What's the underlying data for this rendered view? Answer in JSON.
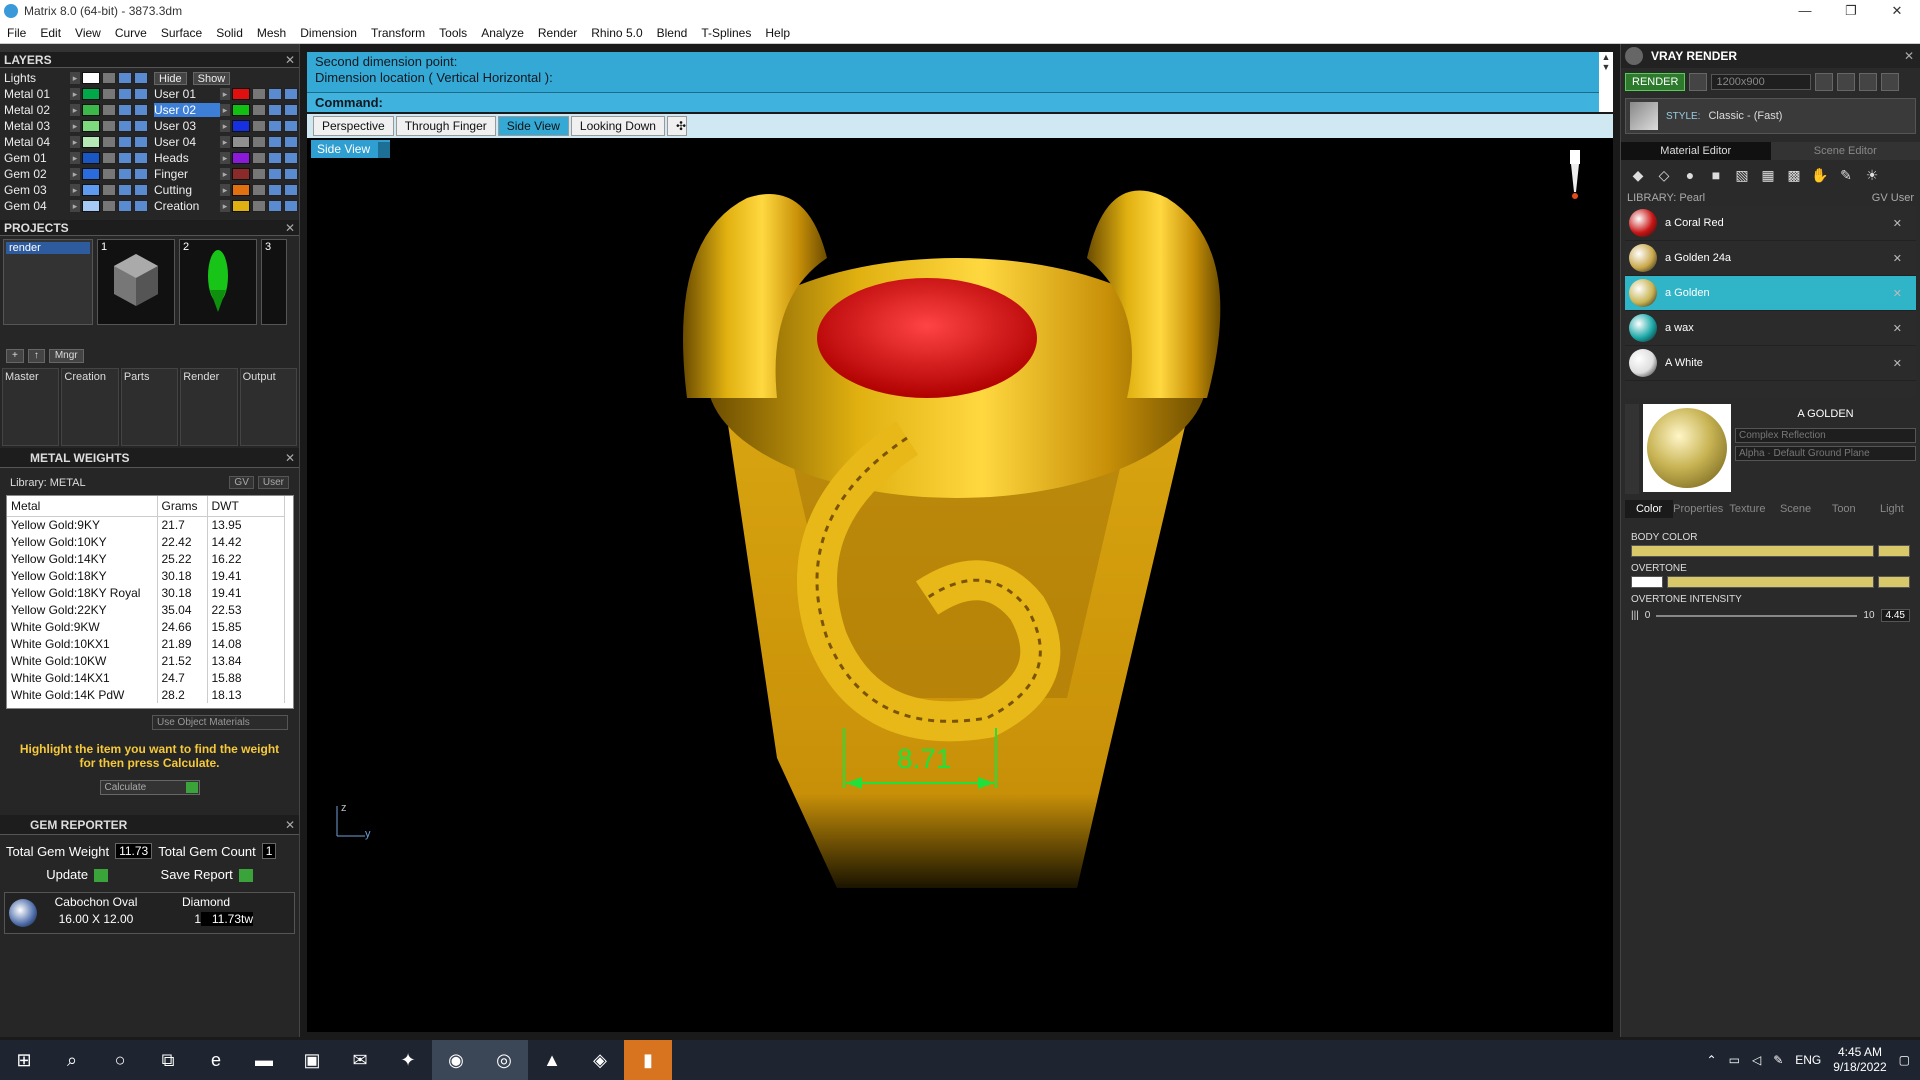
{
  "window": {
    "title": "Matrix 8.0 (64-bit) - 3873.3dm",
    "minimize": "—",
    "restore": "❐",
    "close": "✕"
  },
  "menu": [
    "File",
    "Edit",
    "View",
    "Curve",
    "Surface",
    "Solid",
    "Mesh",
    "Dimension",
    "Transform",
    "Tools",
    "Analyze",
    "Render",
    "Rhino 5.0",
    "Blend",
    "T-Splines",
    "Help"
  ],
  "layers": {
    "title": "LAYERS",
    "close": "✕",
    "hide": "Hide",
    "show": "Show",
    "left": [
      {
        "name": "Lights",
        "color": "#ffffff"
      },
      {
        "name": "Metal 01",
        "color": "#00a84a"
      },
      {
        "name": "Metal 02",
        "color": "#3cb84a"
      },
      {
        "name": "Metal 03",
        "color": "#7ed87e"
      },
      {
        "name": "Metal 04",
        "color": "#b7e9b7"
      },
      {
        "name": "Gem 01",
        "color": "#1a57c2"
      },
      {
        "name": "Gem 02",
        "color": "#2a6bdd"
      },
      {
        "name": "Gem 03",
        "color": "#5e9bf0"
      },
      {
        "name": "Gem 04",
        "color": "#a6c8f5"
      }
    ],
    "right": [
      {
        "name": "",
        "color": ""
      },
      {
        "name": "User 01",
        "color": "#e01010"
      },
      {
        "name": "User 02",
        "color": "#12c012"
      },
      {
        "name": "User 03",
        "color": "#1430e0"
      },
      {
        "name": "User 04",
        "color": "#909090"
      },
      {
        "name": "Heads",
        "color": "#8a1ad8"
      },
      {
        "name": "Finger",
        "color": "#8a2a2a"
      },
      {
        "name": "Cutting",
        "color": "#e07010"
      },
      {
        "name": "Creation",
        "color": "#e0b010"
      }
    ]
  },
  "projects": {
    "title": "PROJECTS",
    "close": "✕",
    "items": [
      "render"
    ],
    "thumbs": [
      "1",
      "2",
      "3"
    ],
    "mngr": "Mngr"
  },
  "categories": [
    "Master",
    "Creation",
    "Parts",
    "Render",
    "Output"
  ],
  "metal_weights": {
    "title": "METAL WEIGHTS",
    "close": "✕",
    "library": "Library: METAL",
    "gv": "GV",
    "user": "User",
    "headers": [
      "Metal",
      "Grams",
      "DWT"
    ],
    "rows": [
      [
        "Yellow Gold:9KY",
        "21.7",
        "13.95"
      ],
      [
        "Yellow Gold:10KY",
        "22.42",
        "14.42"
      ],
      [
        "Yellow Gold:14KY",
        "25.22",
        "16.22"
      ],
      [
        "Yellow Gold:18KY",
        "30.18",
        "19.41"
      ],
      [
        "Yellow Gold:18KY Royal",
        "30.18",
        "19.41"
      ],
      [
        "Yellow Gold:22KY",
        "35.04",
        "22.53"
      ],
      [
        "White Gold:9KW",
        "24.66",
        "15.85"
      ],
      [
        "White Gold:10KX1",
        "21.89",
        "14.08"
      ],
      [
        "White Gold:10KW",
        "21.52",
        "13.84"
      ],
      [
        "White Gold:14KX1",
        "24.7",
        "15.88"
      ],
      [
        "White Gold:14K PdW",
        "28.2",
        "18.13"
      ]
    ],
    "use_object": "Use Object Materials",
    "hint": "Highlight the item you want to find the weight for then press Calculate.",
    "calculate": "Calculate"
  },
  "gem_reporter": {
    "title": "GEM REPORTER",
    "close": "✕",
    "total_weight_label": "Total Gem Weight",
    "total_weight": "11.73",
    "total_count_label": "Total Gem Count",
    "total_count": "1",
    "update": "Update",
    "save": "Save Report",
    "gem": {
      "shape": "Cabochon Oval",
      "size": "16.00 X 12.00",
      "material": "Diamond",
      "count": "1",
      "weight": "11.73tw"
    }
  },
  "command": {
    "line1": "Second dimension point:",
    "line2": "Dimension location ( Vertical  Horizontal ):",
    "prompt": "Command:"
  },
  "view_tabs": [
    {
      "label": "Perspective",
      "active": false
    },
    {
      "label": "Through Finger",
      "active": false
    },
    {
      "label": "Side View",
      "active": true
    },
    {
      "label": "Looking Down",
      "active": false
    }
  ],
  "view_tab_add": "✣",
  "viewport": {
    "label": "Side View",
    "dimension": "8.71",
    "axis_z": "z",
    "axis_y": "y"
  },
  "vray": {
    "title": "VRAY RENDER",
    "close": "✕",
    "render": "RENDER",
    "resolution": "1200x900",
    "style_label": "STYLE:",
    "style_value": "Classic - (Fast)",
    "tabs": [
      "Material Editor",
      "Scene Editor"
    ],
    "library": "LIBRARY: Pearl",
    "gv": "GV",
    "user": "User",
    "materials": [
      {
        "name": "a Coral Red",
        "color": "#c81414",
        "selected": false
      },
      {
        "name": "a Golden 24a",
        "color": "#c9a84c",
        "selected": false
      },
      {
        "name": "a Golden",
        "color": "#c8b454",
        "selected": true
      },
      {
        "name": "a wax",
        "color": "#1aa8a8",
        "selected": false
      },
      {
        "name": "A White",
        "color": "#dedede",
        "selected": false
      }
    ],
    "current": "A GOLDEN",
    "reflection": "Complex Reflection",
    "alpha": "Alpha",
    "ground": "Default Ground Plane",
    "prop_tabs": [
      "Color",
      "Properties",
      "Texture",
      "Scene",
      "Toon",
      "Light"
    ],
    "body_color": "BODY COLOR",
    "overtone": "OVERTONE",
    "overtone_intensity": "OVERTONE INTENSITY",
    "oi_min": "0",
    "oi_max": "10",
    "oi_value": "4.45"
  },
  "taskbar": {
    "lang": "ENG",
    "time": "4:45 AM",
    "date": "9/18/2022"
  }
}
